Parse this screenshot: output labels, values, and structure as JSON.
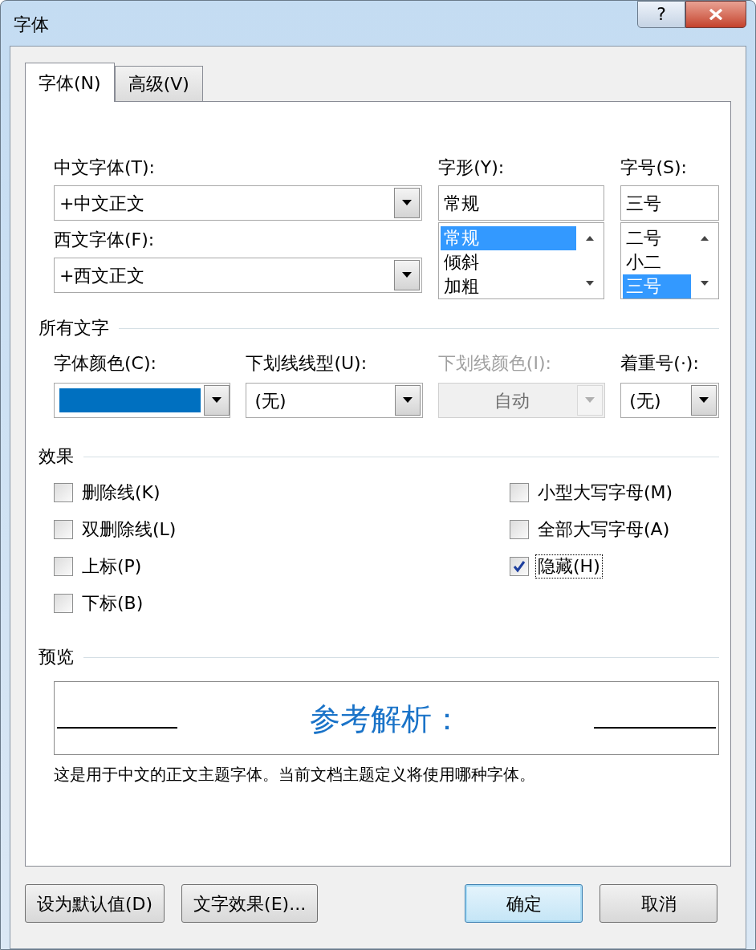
{
  "window": {
    "title": "字体",
    "help": "?"
  },
  "tabs": [
    {
      "label": "字体(N)",
      "selected": true
    },
    {
      "label": "高级(V)",
      "selected": false
    }
  ],
  "font_fields": [
    {
      "label": "中文字体(T):",
      "value": "+中文正文"
    },
    {
      "label": "西文字体(F):",
      "value": "+西文正文"
    }
  ],
  "style_list": {
    "label": "字形(Y):",
    "value": "常规",
    "items": [
      {
        "label": "常规",
        "selected": true
      },
      {
        "label": "倾斜",
        "selected": false
      },
      {
        "label": "加粗",
        "selected": false
      }
    ]
  },
  "size_list": {
    "label": "字号(S):",
    "value": "三号",
    "items": [
      {
        "label": "二号",
        "selected": false
      },
      {
        "label": "小二",
        "selected": false
      },
      {
        "label": "三号",
        "selected": true
      }
    ]
  },
  "all_text": {
    "heading": "所有文字",
    "controls": [
      {
        "kind": "color",
        "label": "字体颜色(C):",
        "color": "#0070c0",
        "disabled": false
      },
      {
        "kind": "dropdown",
        "label": "下划线线型(U):",
        "value": "(无)",
        "disabled": false
      },
      {
        "kind": "dropdown",
        "label": "下划线颜色(I):",
        "value": "自动",
        "disabled": true
      },
      {
        "kind": "dropdown",
        "label": "着重号(·):",
        "value": "(无)",
        "disabled": false
      }
    ]
  },
  "effects": {
    "heading": "效果",
    "left": [
      {
        "label": "删除线(K)",
        "checked": false,
        "focused": false
      },
      {
        "label": "双删除线(L)",
        "checked": false,
        "focused": false
      },
      {
        "label": "上标(P)",
        "checked": false,
        "focused": false
      },
      {
        "label": "下标(B)",
        "checked": false,
        "focused": false
      }
    ],
    "right": [
      {
        "label": "小型大写字母(M)",
        "checked": false,
        "focused": false
      },
      {
        "label": "全部大写字母(A)",
        "checked": false,
        "focused": false
      },
      {
        "label": "隐藏(H)",
        "checked": true,
        "focused": true
      }
    ]
  },
  "preview": {
    "heading": "预览",
    "sample": "参考解析：",
    "description": "这是用于中文的正文主题字体。当前文档主题定义将使用哪种字体。"
  },
  "buttons": [
    {
      "label": "设为默认值(D)",
      "default": false
    },
    {
      "label": "文字效果(E)...",
      "default": false
    },
    {
      "label": "确定",
      "default": true
    },
    {
      "label": "取消",
      "default": false
    }
  ]
}
